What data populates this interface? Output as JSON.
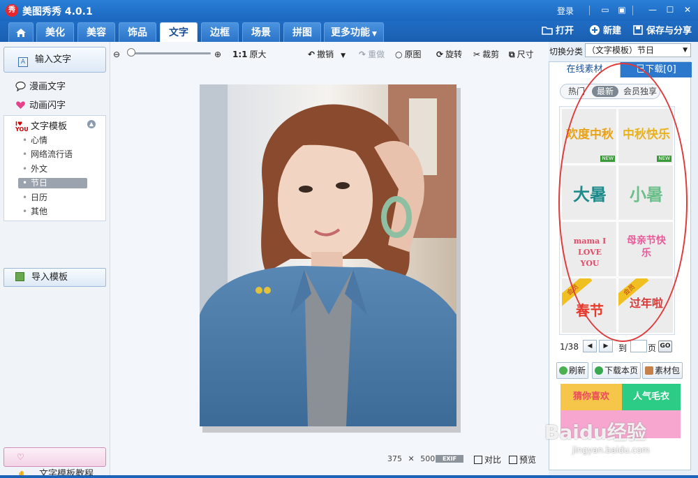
{
  "app": {
    "logo_char": "秀",
    "title": "美图秀秀 4.0.1"
  },
  "window": {
    "login": "登录"
  },
  "tabs": [
    {
      "label": "美化"
    },
    {
      "label": "美容"
    },
    {
      "label": "饰品"
    },
    {
      "label": "文字"
    },
    {
      "label": "边框"
    },
    {
      "label": "场景"
    },
    {
      "label": "拼图"
    },
    {
      "label": "更多功能"
    }
  ],
  "top_actions": {
    "open": "打开",
    "new": "新建",
    "save_share": "保存与分享"
  },
  "left": {
    "input_text": "输入文字",
    "comic_text": "漫画文字",
    "animated_text": "动画闪字",
    "template_header": "文字模板",
    "template_icon_text": "I♥ YOU",
    "template_items": [
      "心情",
      "网络流行语",
      "外文",
      "节日",
      "日历",
      "其他"
    ],
    "selected_item": "节日",
    "import_template": "导入模板",
    "tutorial": "文字模板教程"
  },
  "toolbar": {
    "zoom_level_percent": 0,
    "ratio_icon": "1:1",
    "original_size": "原大",
    "undo": "撤销",
    "redo": "重做",
    "original_image": "原图",
    "rotate": "旋转",
    "crop": "裁剪",
    "size": "尺寸"
  },
  "canvas": {
    "width": "375",
    "times": "✕",
    "height": "500",
    "exif": "EXIF",
    "compare": "对比",
    "preview": "预览"
  },
  "right": {
    "switch_label": "切换分类",
    "category": "（文字模板）节日",
    "tabs": [
      "在线素材",
      "已下载[0]"
    ],
    "filters": [
      "热门",
      "最新",
      "会员独享"
    ],
    "active_filter": "最新",
    "materials": [
      {
        "text": "欢度中秋",
        "color": "#e8a318",
        "badge": "NEW"
      },
      {
        "text": "中秋快乐",
        "color": "#e9b21c",
        "badge": "NEW"
      },
      {
        "text": "大暑",
        "color": "#1e8a8a",
        "badge": ""
      },
      {
        "text": "小暑",
        "color": "#6bbf8a",
        "badge": ""
      },
      {
        "text": "mama I LOVE YOU",
        "color": "#e24a6a",
        "badge": ""
      },
      {
        "text": "母亲节快乐",
        "color": "#e85a9a",
        "badge": ""
      },
      {
        "text": "春节",
        "color": "#e83a2a",
        "badge": "会员"
      },
      {
        "text": "过年啦",
        "color": "#d83a3a",
        "badge": "会员"
      }
    ],
    "pager": {
      "page": "1/38",
      "goto": "到",
      "page_unit": "页",
      "go": "GO"
    },
    "actions": {
      "refresh": "刷新",
      "download_page": "下载本页",
      "material_pack": "素材包"
    },
    "banners": {
      "guess": "猜你喜欢",
      "popular": "人气毛衣"
    }
  },
  "watermark": {
    "text": "Baidu经验",
    "url": "jingyan.baidu.com"
  }
}
